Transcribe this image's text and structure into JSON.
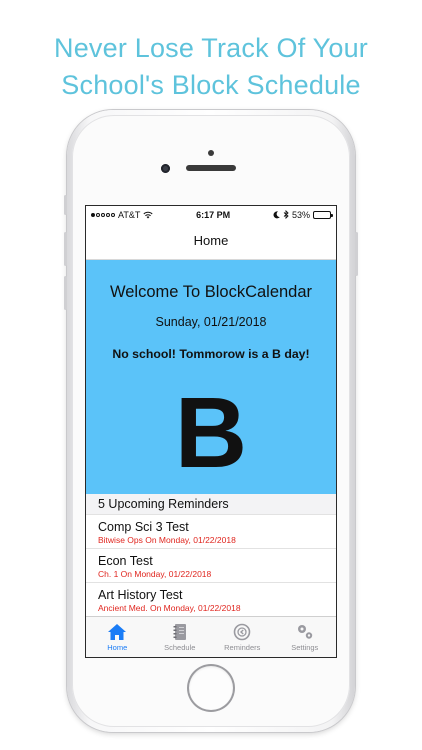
{
  "headline": {
    "line1": "Never Lose Track Of Your",
    "line2": "School's Block Schedule"
  },
  "status_bar": {
    "carrier": "AT&T",
    "time": "6:17 PM",
    "battery": "53%",
    "battery_level": 0.53
  },
  "navbar": {
    "title": "Home"
  },
  "hero": {
    "title": "Welcome To BlockCalendar",
    "date": "Sunday, 01/21/2018",
    "message": "No school! Tommorow is a B day!",
    "day_letter": "B",
    "background_color": "#5bc3f9"
  },
  "reminders": {
    "header": "5 Upcoming Reminders",
    "items": [
      {
        "title": "Comp Sci 3 Test",
        "subtitle": "Bitwise Ops On Monday, 01/22/2018"
      },
      {
        "title": "Econ Test",
        "subtitle": "Ch. 1 On Monday, 01/22/2018"
      },
      {
        "title": "Art History Test",
        "subtitle": "Ancient Med. On Monday, 01/22/2018"
      }
    ]
  },
  "tabbar": {
    "tabs": [
      {
        "label": "Home",
        "icon": "home-icon",
        "active": true
      },
      {
        "label": "Schedule",
        "icon": "notebook-icon",
        "active": false
      },
      {
        "label": "Reminders",
        "icon": "reminder-icon",
        "active": false
      },
      {
        "label": "Settings",
        "icon": "gear-icon",
        "active": false
      }
    ]
  },
  "colors": {
    "accent": "#1a7cf6",
    "headline": "#5ec3dc",
    "reminder_subtitle": "#e0261f"
  }
}
